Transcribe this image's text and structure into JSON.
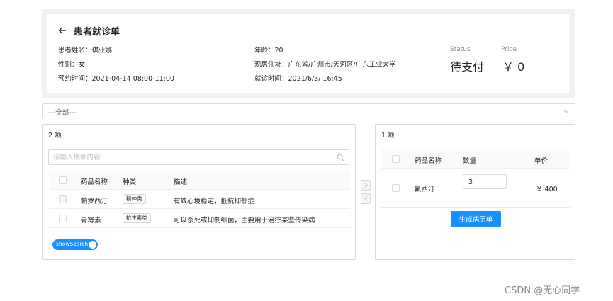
{
  "header": {
    "title": "患者就诊单",
    "patient_name": {
      "label": "患者姓名：",
      "value": "琪亚娜"
    },
    "gender": {
      "label": "性别：",
      "value": "女"
    },
    "appointment": {
      "label": "预约时间：",
      "value": "2021-04-14 08:00-11:00"
    },
    "age": {
      "label": "年龄：",
      "value": "20"
    },
    "address": {
      "label": "现居住址：",
      "value": "广东省/广州市/天河区/广东工业大学"
    },
    "visit_time": {
      "label": "就诊时间：",
      "value": "2021/6/3/ 16:45"
    },
    "status": {
      "title": "Status",
      "value": "待支付"
    },
    "price": {
      "title": "Price",
      "value": "￥ 0"
    }
  },
  "filter": {
    "selected": "---全部---"
  },
  "left_panel": {
    "count": "2 项",
    "search_placeholder": "请输入搜索内容",
    "columns": [
      "药品名称",
      "种类",
      "描述"
    ],
    "rows": [
      {
        "name": "帕罗西汀",
        "category": "精神类",
        "description": "有效心境稳定，抵抗抑郁症",
        "disabled": true
      },
      {
        "name": "青霉素",
        "category": "抗生素类",
        "description": "可以杀死或抑制细菌，主要用于治疗某些传染病",
        "disabled": false
      }
    ],
    "switch_label": "showSearch"
  },
  "right_panel": {
    "count": "1 项",
    "columns": [
      "药品名称",
      "数量",
      "单价"
    ],
    "rows": [
      {
        "name": "氟西汀",
        "quantity": "3",
        "price": "￥ 400"
      }
    ],
    "submit_label": "生成病历单"
  },
  "watermark": "CSDN @无心同学",
  "colors": {
    "primary": "#1890ff",
    "border": "#d9d9d9",
    "header_bg": "#f0f2f5",
    "table_head_bg": "#fafafa"
  }
}
